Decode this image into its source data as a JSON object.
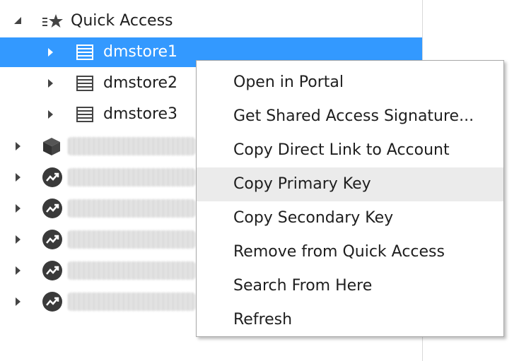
{
  "tree": {
    "quick_access": {
      "label": "Quick Access",
      "icon": "quick-access-icon"
    },
    "quick_items": [
      {
        "label": "dmstore1",
        "icon": "storage-table-icon",
        "selected": true
      },
      {
        "label": "dmstore2",
        "icon": "storage-table-icon"
      },
      {
        "label": "dmstore3",
        "icon": "storage-table-icon"
      }
    ],
    "other_items": [
      {
        "icon": "cube-icon"
      },
      {
        "icon": "trend-icon"
      },
      {
        "icon": "trend-icon"
      },
      {
        "icon": "trend-icon"
      },
      {
        "icon": "trend-icon"
      },
      {
        "icon": "trend-icon"
      }
    ]
  },
  "context_menu": {
    "items": [
      "Open in Portal",
      "Get Shared Access Signature...",
      "Copy Direct Link to Account",
      "Copy Primary Key",
      "Copy Secondary Key",
      "Remove from Quick Access",
      "Search From Here",
      "Refresh"
    ],
    "hovered_index": 3
  },
  "colors": {
    "selection": "#3399ff",
    "hover": "#ebebeb"
  }
}
